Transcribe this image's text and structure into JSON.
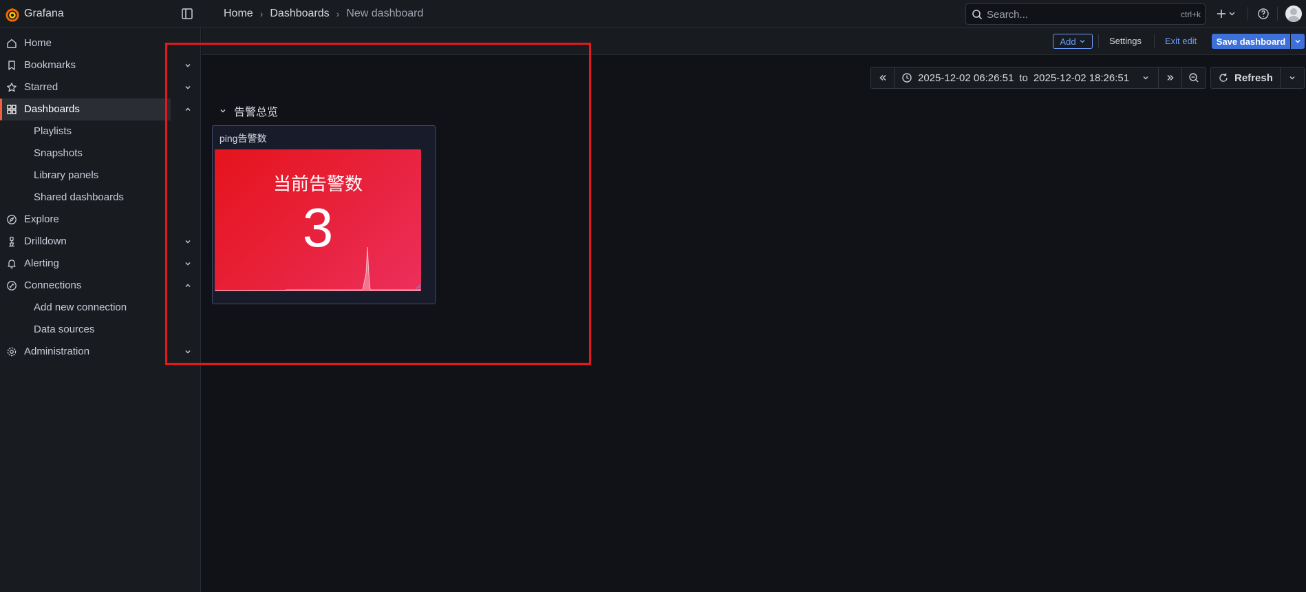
{
  "app": {
    "name": "Grafana"
  },
  "breadcrumb": [
    "Home",
    "Dashboards",
    "New dashboard"
  ],
  "search": {
    "placeholder": "Search...",
    "shortcut": "ctrl+k"
  },
  "sidebar": {
    "items": [
      {
        "label": "Home",
        "icon": "home-icon"
      },
      {
        "label": "Bookmarks",
        "icon": "bookmark-icon",
        "chevron": "down"
      },
      {
        "label": "Starred",
        "icon": "star-icon",
        "chevron": "down"
      },
      {
        "label": "Dashboards",
        "icon": "dashboards-icon",
        "chevron": "up",
        "active": true
      },
      {
        "label": "Playlists",
        "sub": true
      },
      {
        "label": "Snapshots",
        "sub": true
      },
      {
        "label": "Library panels",
        "sub": true
      },
      {
        "label": "Shared dashboards",
        "sub": true
      },
      {
        "label": "Explore",
        "icon": "compass-icon"
      },
      {
        "label": "Drilldown",
        "icon": "drilldown-icon",
        "chevron": "down"
      },
      {
        "label": "Alerting",
        "icon": "bell-icon",
        "chevron": "down"
      },
      {
        "label": "Connections",
        "icon": "connections-icon",
        "chevron": "up"
      },
      {
        "label": "Add new connection",
        "sub": true
      },
      {
        "label": "Data sources",
        "sub": true
      },
      {
        "label": "Administration",
        "icon": "gear-icon",
        "chevron": "down"
      }
    ]
  },
  "edit_toolbar": {
    "add_label": "Add",
    "settings_label": "Settings",
    "exit_label": "Exit edit",
    "save_label": "Save dashboard"
  },
  "time_picker": {
    "from": "2025-12-02 06:26:51",
    "connector": "to",
    "to": "2025-12-02 18:26:51",
    "refresh_label": "Refresh"
  },
  "row": {
    "title": "告警总览"
  },
  "panel": {
    "title": "ping告警数",
    "stat_label": "当前告警数",
    "value": "3"
  },
  "colors": {
    "accent": "#f55f3e",
    "primary": "#3d71d9",
    "link": "#6e9fff",
    "stat_bg": "#e5141c",
    "annotation_box": "#e5191d"
  }
}
